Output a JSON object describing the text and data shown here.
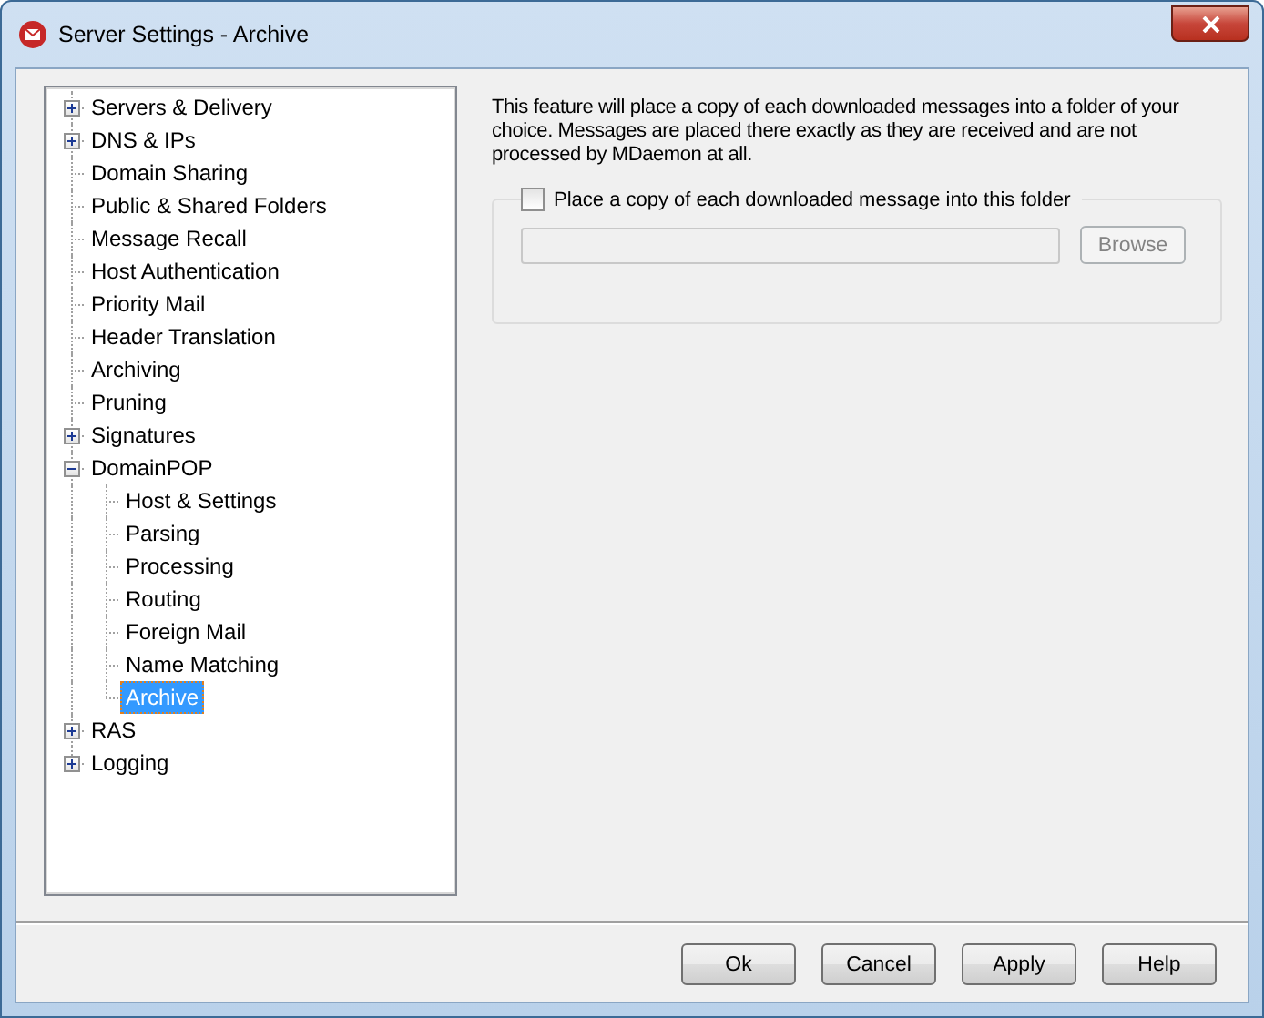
{
  "window": {
    "title": "Server Settings - Archive"
  },
  "tree": [
    {
      "label": "Servers & Delivery",
      "expanded": false,
      "selected": false
    },
    {
      "label": "DNS & IPs",
      "expanded": false,
      "selected": false
    },
    {
      "label": "Domain Sharing",
      "selected": false
    },
    {
      "label": "Public & Shared Folders",
      "selected": false
    },
    {
      "label": "Message Recall",
      "selected": false
    },
    {
      "label": "Host Authentication",
      "selected": false
    },
    {
      "label": "Priority Mail",
      "selected": false
    },
    {
      "label": "Header Translation",
      "selected": false
    },
    {
      "label": "Archiving",
      "selected": false
    },
    {
      "label": "Pruning",
      "selected": false
    },
    {
      "label": "Signatures",
      "expanded": false,
      "selected": false
    },
    {
      "label": "DomainPOP",
      "expanded": true,
      "selected": false,
      "children": [
        {
          "label": "Host & Settings",
          "selected": false
        },
        {
          "label": "Parsing",
          "selected": false
        },
        {
          "label": "Processing",
          "selected": false
        },
        {
          "label": "Routing",
          "selected": false
        },
        {
          "label": "Foreign Mail",
          "selected": false
        },
        {
          "label": "Name Matching",
          "selected": false
        },
        {
          "label": "Archive",
          "selected": true
        }
      ]
    },
    {
      "label": "RAS",
      "expanded": false,
      "selected": false
    },
    {
      "label": "Logging",
      "expanded": false,
      "selected": false
    }
  ],
  "description": "This feature will place a copy of each downloaded messages into a folder of your choice.  Messages are placed there exactly as they are received and are not processed by MDaemon at all.",
  "archive_group": {
    "checkbox": {
      "label": "Place a copy of each downloaded message into this folder",
      "checked": false
    },
    "folder_field": {
      "disabled": true
    },
    "browse_button": {
      "label": "Browse",
      "disabled": true
    }
  },
  "buttons": [
    "Ok",
    "Cancel",
    "Apply",
    "Help"
  ]
}
